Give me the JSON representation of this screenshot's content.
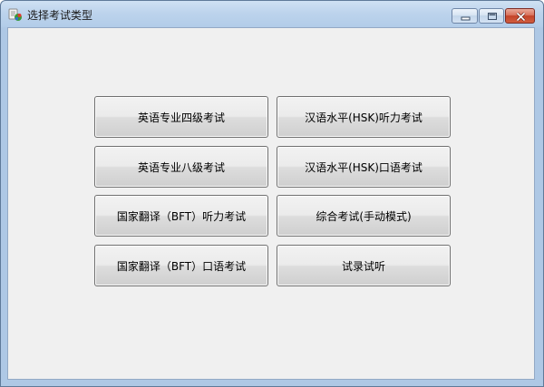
{
  "window": {
    "title": "选择考试类型"
  },
  "buttons": {
    "b1": "英语专业四级考试",
    "b2": "汉语水平(HSK)听力考试",
    "b3": "英语专业八级考试",
    "b4": "汉语水平(HSK)口语考试",
    "b5": "国家翻译（BFT）听力考试",
    "b6": "综合考试(手动模式)",
    "b7": "国家翻译（BFT）口语考试",
    "b8": "试录试听"
  },
  "colors": {
    "window_frame": "#aec8e5",
    "client_background": "#f0f0f0",
    "close_button": "#c34329"
  },
  "icons": {
    "app": "app-logo-icon",
    "minimize": "minimize-icon",
    "maximize": "maximize-icon",
    "close": "close-icon"
  }
}
